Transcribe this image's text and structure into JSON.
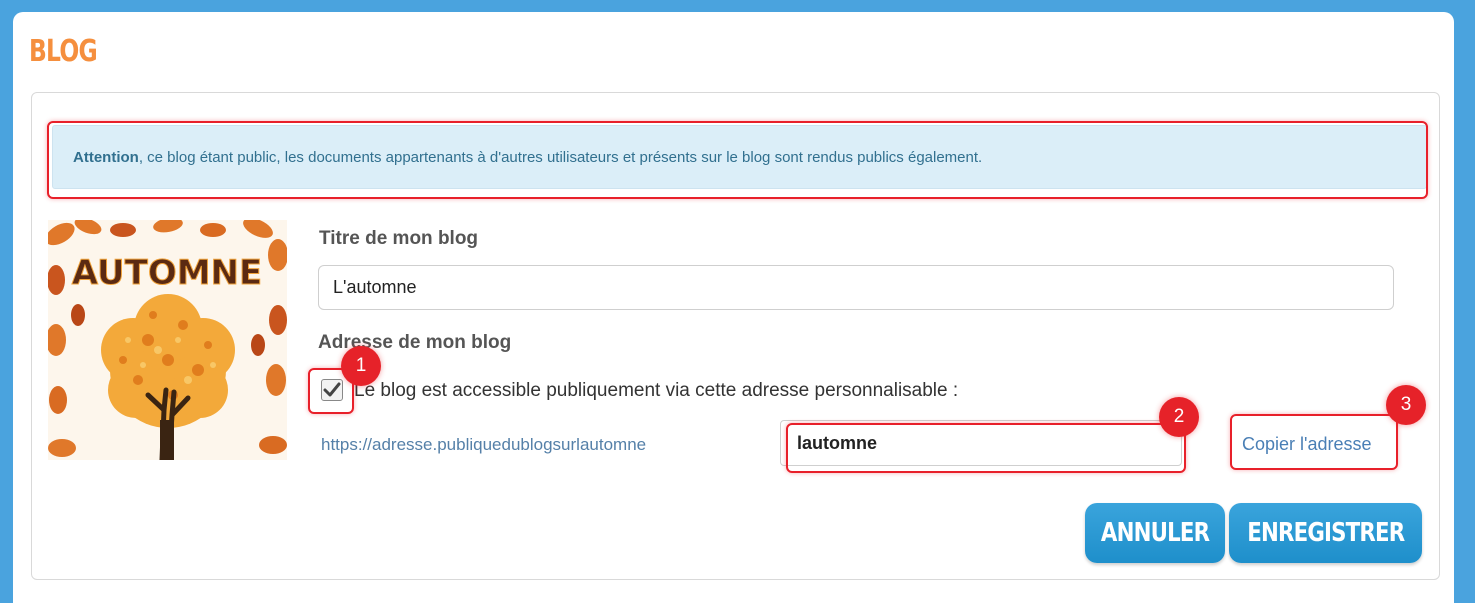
{
  "page": {
    "title": "BLOG"
  },
  "alert": {
    "strong": "Attention",
    "text": ", ce blog étant public, les documents appartenants à d'autres utilisateurs et présents sur le blog sont rendus publics également."
  },
  "thumbnail": {
    "word": "AUTOMNE",
    "icon": "autumn-tree-image"
  },
  "form": {
    "title_label": "Titre de mon blog",
    "title_value": "L'automne",
    "address_label": "Adresse de mon blog",
    "public_checkbox_checked": true,
    "public_checkbox_label": "Le blog est accessible publiquement via cette adresse personnalisable :",
    "url_prefix": "https://adresse.publiquedublogsurlautomne",
    "slug_value": "lautomne",
    "copy_link": "Copier l'adresse"
  },
  "annotations": {
    "badge1": "1",
    "badge2": "2",
    "badge3": "3",
    "color": "#e62229"
  },
  "buttons": {
    "cancel": "ANNULER",
    "save": "ENREGISTRER"
  },
  "colors": {
    "accent": "#f58f3e",
    "button": "#2a9ad6",
    "background": "#4aa3de",
    "alert_bg": "#dbeef8"
  }
}
